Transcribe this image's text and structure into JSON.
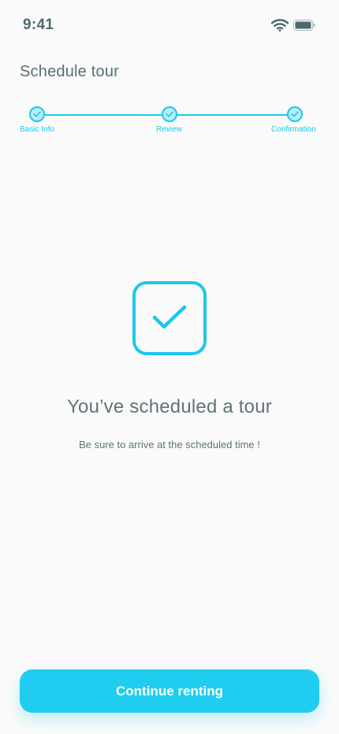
{
  "status_bar": {
    "time": "9:41",
    "icons": [
      "wifi-icon",
      "battery-icon"
    ]
  },
  "header": {
    "title": "Schedule tour"
  },
  "stepper": {
    "steps": [
      {
        "label": "Basic Info",
        "state": "complete"
      },
      {
        "label": "Review",
        "state": "complete"
      },
      {
        "label": "Confirmation",
        "state": "complete"
      }
    ]
  },
  "confirmation": {
    "icon": "checkmark-square-icon",
    "title": "You’ve scheduled a tour",
    "subtitle": "Be sure to arrive at the scheduled time !"
  },
  "actions": {
    "continue_label": "Continue renting"
  },
  "colors": {
    "accent": "#1cc8ec",
    "text": "#5e7578",
    "background": "#fafafa"
  }
}
